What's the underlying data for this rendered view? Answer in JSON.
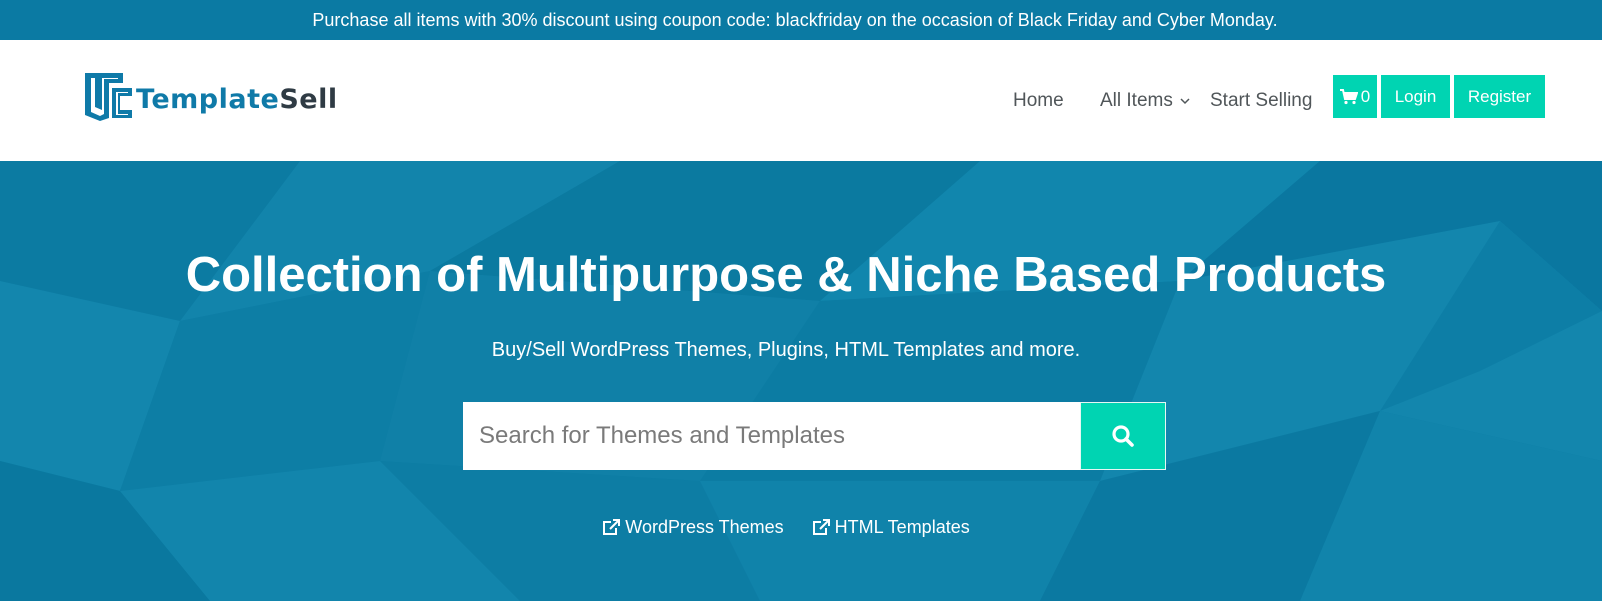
{
  "promo": {
    "text": "Purchase all items with 30% discount using coupon code: blackfriday on the occasion of Black Friday and Cyber Monday."
  },
  "logo": {
    "part1": "Template",
    "part2": "Sell",
    "icon": "templatesell-logo-icon"
  },
  "nav": {
    "home": "Home",
    "all_items": "All Items",
    "start_selling": "Start Selling",
    "cart_count": "0",
    "login": "Login",
    "register": "Register"
  },
  "hero": {
    "title": "Collection of Multipurpose & Niche Based Products",
    "subtitle": "Buy/Sell WordPress Themes, Plugins, HTML Templates and more.",
    "search_placeholder": "Search for Themes and Templates",
    "links": [
      {
        "label": "WordPress Themes",
        "icon": "external-link-icon"
      },
      {
        "label": "HTML Templates",
        "icon": "external-link-icon"
      }
    ]
  },
  "colors": {
    "brand_blue": "#0b7aa3",
    "accent_teal": "#00d4b2",
    "hero_bg": "#0e7da4"
  }
}
